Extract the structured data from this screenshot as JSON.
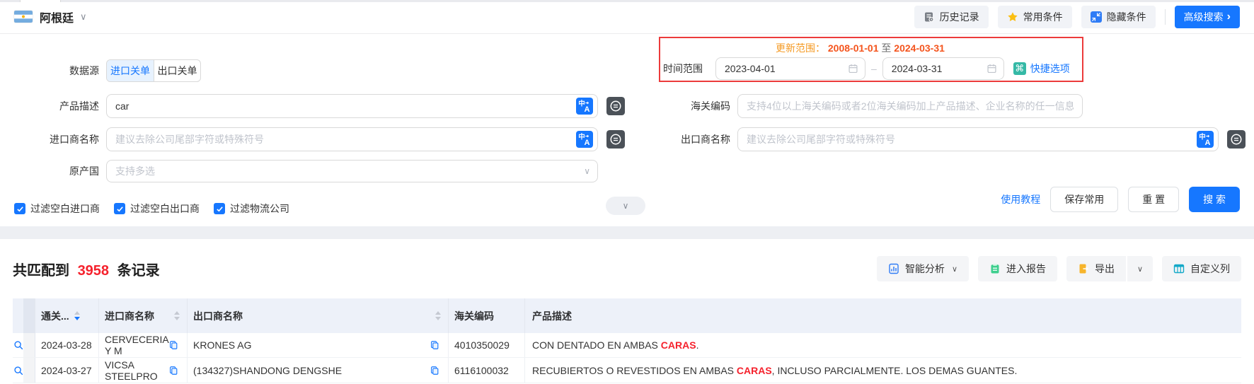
{
  "colors": {
    "accent_blue": "#1677ff",
    "highlight_red": "#f5222d",
    "update_orange": "#f4541d",
    "update_label_orange": "#f59a23",
    "quick_teal": "#35b9a6",
    "star_yellow": "#fbbf12",
    "report_green": "#3ecf8e",
    "export_orange": "#f7b52c",
    "redbox_border": "#ec3b3b"
  },
  "icons": {
    "chevron_down": "∨",
    "chevron_right": "›",
    "command": "⌘",
    "dash": "–",
    "translate_zh": "中",
    "translate_a": "A"
  },
  "topbar": {
    "country": "阿根廷",
    "history": "历史记录",
    "favorites": "常用条件",
    "hide_conditions": "隐藏条件",
    "advanced_search": "高级搜索"
  },
  "form": {
    "datasource": {
      "label": "数据源",
      "tab_import": "进口关单",
      "tab_export": "出口关单"
    },
    "product_desc": {
      "label": "产品描述",
      "value": "car"
    },
    "importer": {
      "label": "进口商名称",
      "placeholder": "建议去除公司尾部字符或特殊符号"
    },
    "origin": {
      "label": "原产国",
      "placeholder": "支持多选"
    },
    "update_range": {
      "label": "更新范围：",
      "start": "2008-01-01",
      "to": "至",
      "end": "2024-03-31"
    },
    "time_range": {
      "label": "时间范围",
      "start": "2023-04-01",
      "end": "2024-03-31",
      "quick_label": "快捷选项"
    },
    "hscode": {
      "label": "海关编码",
      "placeholder": "支持4位以上海关编码或者2位海关编码加上产品描述、企业名称的任一信息"
    },
    "exporter": {
      "label": "出口商名称",
      "placeholder": "建议去除公司尾部字符或特殊符号"
    },
    "checkboxes": [
      {
        "label": "过滤空白进口商",
        "checked": true
      },
      {
        "label": "过滤空白出口商",
        "checked": true
      },
      {
        "label": "过滤物流公司",
        "checked": true
      }
    ],
    "actions": {
      "tutorial": "使用教程",
      "save": "保存常用",
      "reset": "重 置",
      "search": "搜 索"
    }
  },
  "results": {
    "count_prefix": "共匹配到",
    "count": "3958",
    "count_suffix": "条记录",
    "toolbar": {
      "analysis": "智能分析",
      "report": "进入报告",
      "export": "导出",
      "custom_columns": "自定义列"
    },
    "table": {
      "headers": {
        "date": "通关...",
        "importer": "进口商名称",
        "exporter": "出口商名称",
        "hscode": "海关编码",
        "desc": "产品描述"
      },
      "rows": [
        {
          "date": "2024-03-28",
          "importer": "CERVECERIA Y M",
          "exporter": "KRONES AG",
          "hscode": "4010350029",
          "desc_pre": "CON DENTADO EN AMBAS ",
          "desc_hl": "CARAS",
          "desc_post": "."
        },
        {
          "date": "2024-03-27",
          "importer": "VICSA STEELPRO",
          "exporter": "(134327)SHANDONG DENGSHE",
          "hscode": "6116100032",
          "desc_pre": "RECUBIERTOS O REVESTIDOS EN AMBAS ",
          "desc_hl": "CARAS",
          "desc_post": ", INCLUSO PARCIALMENTE. LOS DEMAS GUANTES."
        }
      ]
    }
  }
}
